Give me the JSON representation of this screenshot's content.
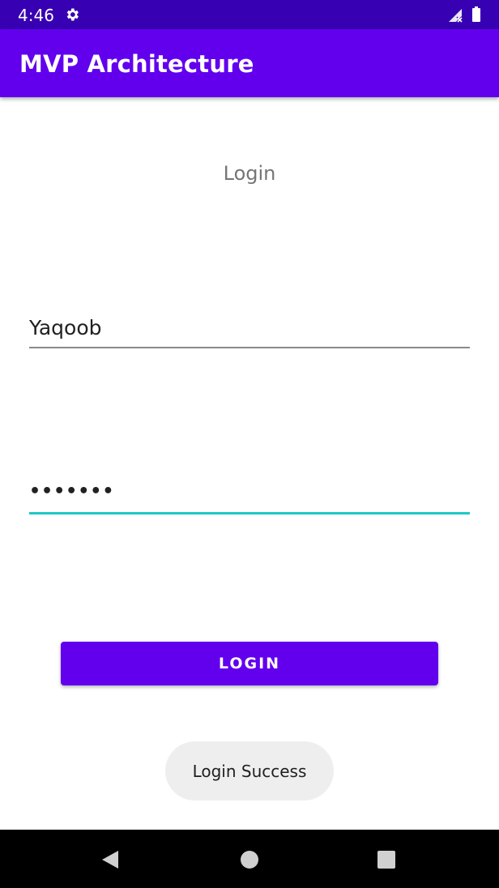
{
  "status_bar": {
    "time": "4:46"
  },
  "app_bar": {
    "title": "MVP Architecture"
  },
  "form": {
    "heading": "Login",
    "username_value": "Yaqoob",
    "password_value": "•••••••",
    "login_button_label": "LOGIN"
  },
  "toast": {
    "message": "Login Success"
  },
  "colors": {
    "primary": "#6200ee",
    "primary_dark": "#3700b3",
    "accent": "#1ec8c8"
  },
  "icons": {
    "status": [
      "gear-icon",
      "signal-icon",
      "battery-icon"
    ],
    "navigation": [
      "back-icon",
      "home-icon",
      "recents-icon"
    ]
  }
}
